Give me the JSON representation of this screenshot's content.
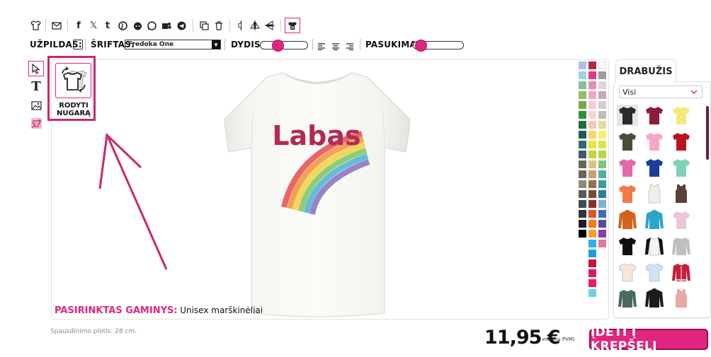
{
  "toolbar": {
    "icons": [
      "tshirt-icon",
      "email-icon",
      "facebook-icon",
      "x-icon",
      "tumblr-icon",
      "pinterest-icon",
      "reddit-icon",
      "whatsapp-icon",
      "teams-icon",
      "telegram-icon",
      "duplicate-icon",
      "trash-icon",
      "align-center-icon",
      "flip-horizontal-icon",
      "flip-vertical-icon",
      "show-back-icon"
    ],
    "fill_label": "UŽPILDAS:",
    "font_label": "ŠRIFTAS:",
    "font_value": "Fredoka One",
    "size_label": "DYDIS:",
    "rotate_label": "PASUKIMAS:",
    "size_level": 0.32,
    "rotate_level": 0.04
  },
  "tools": [
    "select-tool",
    "text-tool",
    "image-tool",
    "clipart-tool"
  ],
  "show_back": {
    "line1": "RODYTI",
    "line2": "NUGARĄ"
  },
  "design": {
    "text": "Labas",
    "text_color": "#b42a52"
  },
  "selected_product": {
    "label": "PASIRINKTAS GAMINYS:",
    "value": "Unisex marškinėliai"
  },
  "print_width": "Spausdinimo plotis: 28 cm.",
  "panel": {
    "tab": "DRABUŽIS",
    "filter": "Visi"
  },
  "price": {
    "amount": "11,95 €",
    "note": "vnt. (su PVM)"
  },
  "cart_button": "ĮDĖTI Į KREPŠELĮ",
  "colors": {
    "accent": "#e0267f",
    "annotation": "#c8286e"
  }
}
